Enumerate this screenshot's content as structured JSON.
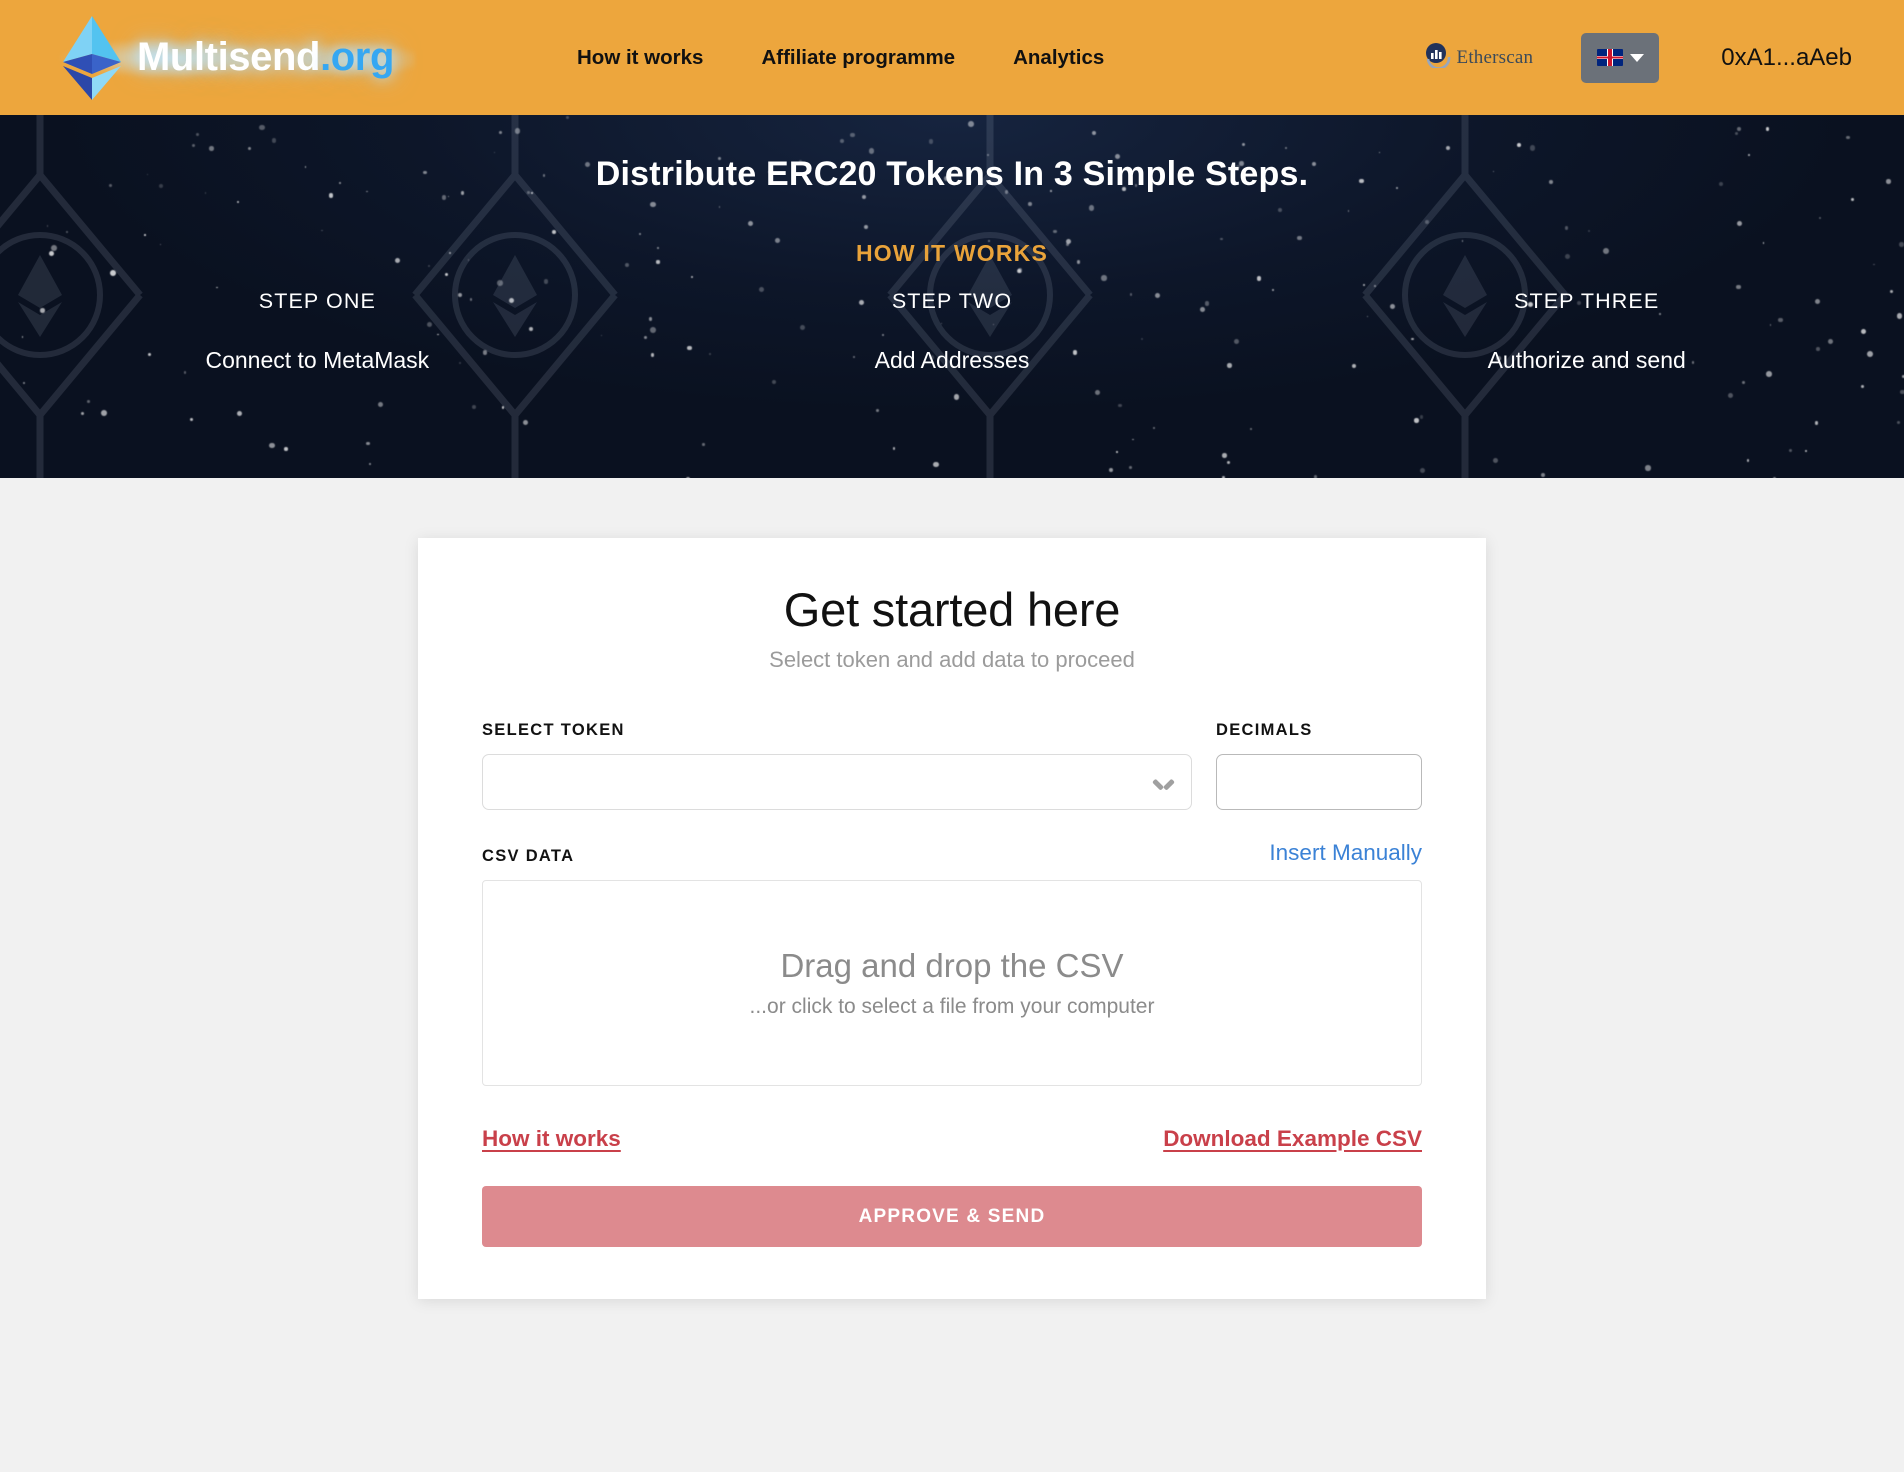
{
  "header": {
    "logo": {
      "name_white": "Multisend",
      "name_blue": ".org",
      "icon": "ethereum-diamond-icon"
    },
    "nav": [
      {
        "label": "How it works"
      },
      {
        "label": "Affiliate programme"
      },
      {
        "label": "Analytics"
      }
    ],
    "etherscan": {
      "label": "Etherscan",
      "icon": "etherscan-logo-icon"
    },
    "language": {
      "selected": "en",
      "flag": "uk-flag-icon",
      "caret": "chevron-down-icon"
    },
    "wallet": {
      "address": "0xA1...aAeb"
    },
    "colors": {
      "background": "#eda63d",
      "logo_blue": "#35a7f2"
    }
  },
  "hero": {
    "title": "Distribute ERC20 Tokens In 3 Simple Steps.",
    "kicker": "HOW IT WORKS",
    "steps": [
      {
        "title": "STEP ONE",
        "desc": "Connect to MetaMask"
      },
      {
        "title": "STEP TWO",
        "desc": "Add Addresses"
      },
      {
        "title": "STEP THREE",
        "desc": "Authorize and send"
      }
    ],
    "colors": {
      "background": "#0d1629",
      "kicker": "#e9a33a"
    }
  },
  "card": {
    "title": "Get started here",
    "subtitle": "Select token and add data to proceed",
    "select_token": {
      "label": "SELECT TOKEN",
      "value": "",
      "placeholder": ""
    },
    "decimals": {
      "label": "DECIMALS",
      "value": "",
      "placeholder": ""
    },
    "csv": {
      "label": "CSV DATA",
      "insert_manually": "Insert Manually",
      "dropzone_title": "Drag and drop the CSV",
      "dropzone_sub": "...or click to select a file from your computer"
    },
    "links": {
      "how_it_works": "How it works",
      "download_example": "Download Example CSV"
    },
    "submit": {
      "label": "APPROVE & SEND",
      "color": "#dd8a8f",
      "state": "disabled"
    }
  }
}
